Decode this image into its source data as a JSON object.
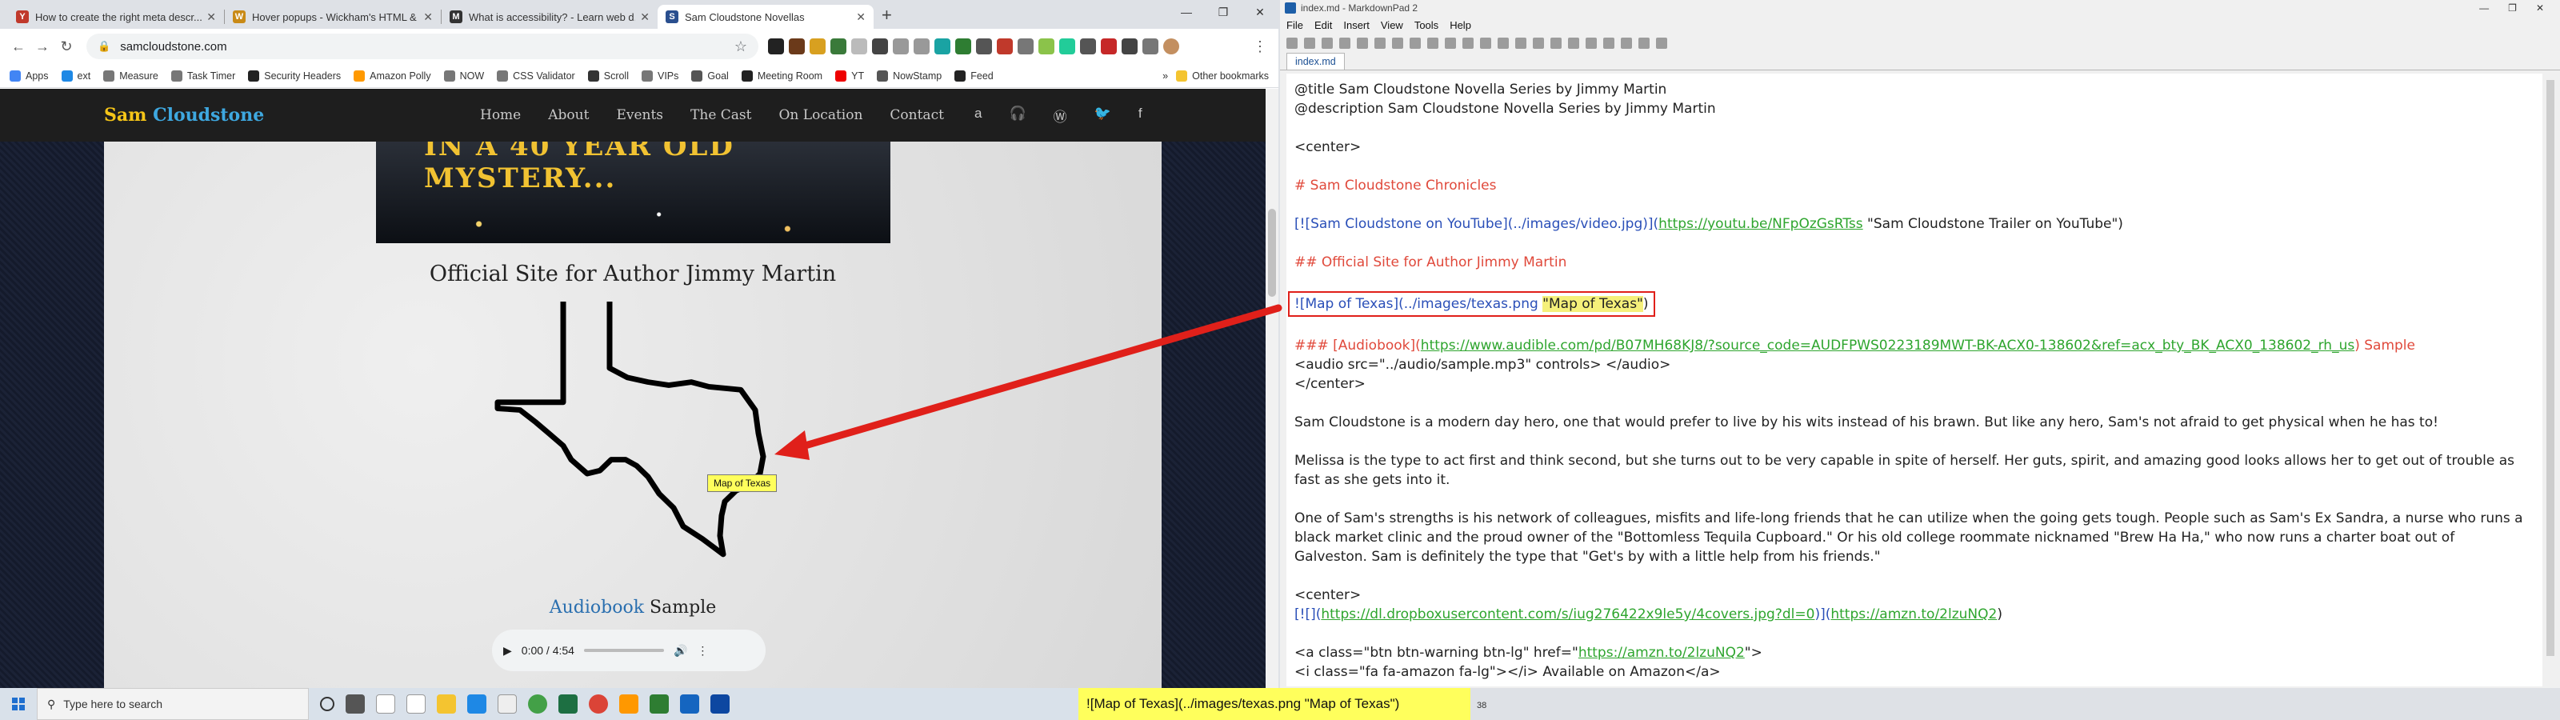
{
  "browser": {
    "tabs": [
      {
        "title": "How to create the right meta descr...",
        "fav_color": "#c0392b",
        "fav_letter": "Y"
      },
      {
        "title": "Hover popups - Wickham's HTML & ...",
        "fav_color": "#c98a16",
        "fav_letter": "W"
      },
      {
        "title": "What is accessibility? - Learn web d...",
        "fav_color": "#333",
        "fav_letter": "M"
      },
      {
        "title": "Sam Cloudstone Novellas",
        "fav_color": "#2a4f8f",
        "fav_letter": "S",
        "active": true
      }
    ],
    "new_tab_label": "+",
    "url": "samcloudstone.com",
    "bookmarks": [
      "Apps",
      "ext",
      "Measure",
      "Task Timer",
      "Security Headers",
      "Amazon Polly",
      "NOW",
      "CSS Validator",
      "Scroll",
      "VIPs",
      "Goal",
      "Meeting Room",
      "YT",
      "NowStamp",
      "Feed"
    ],
    "bookmarks_more": "»",
    "other_bookmarks": "Other bookmarks"
  },
  "site": {
    "brand_first": "Sam",
    "brand_second": "Cloudstone",
    "nav": [
      "Home",
      "About",
      "Events",
      "The Cast",
      "On Location",
      "Contact"
    ],
    "video_text": "IN A 40 YEAR OLD MYSTERY...",
    "heading": "Official Site for Author Jimmy Martin",
    "tooltip": "Map of Texas",
    "audiobook_link": "Audiobook",
    "audiobook_rest": " Sample",
    "audio_time": "0:00 / 4:54"
  },
  "editor": {
    "window_title": "index.md - MarkdownPad 2",
    "menu": [
      "File",
      "Edit",
      "Insert",
      "View",
      "Tools",
      "Help"
    ],
    "tab": "index.md",
    "lines": {
      "title": "@title Sam Cloudstone Novella Series by Jimmy Martin",
      "description": "@description Sam Cloudstone Novella Series by Jimmy Martin",
      "center_open": "<center>",
      "h1": "# Sam Cloudstone Chronicles",
      "video_a": "[![Sam Cloudstone on YouTube](../images/video.jpg)](",
      "video_url": "https://youtu.be/NFpOzGsRTss",
      "video_b": " \"Sam Cloudstone Trailer on YouTube\")",
      "h2": "## Official Site for Author Jimmy Martin",
      "img_a": "![Map of Texas](../images/texas.png ",
      "img_title": "\"Map of Texas\"",
      "img_b": ")",
      "h3_a": "### [Audiobook](",
      "h3_url": "https://www.audible.com/pd/B07MH68KJ8/?source_code=AUDFPWS0223189MWT-BK-ACX0-138602&ref=acx_bty_BK_ACX0_138602_rh_us",
      "h3_b": ") Sample",
      "audio_tag": "<audio src=\"../audio/sample.mp3\" controls> </audio>",
      "center_close": "</center>",
      "p1": "Sam Cloudstone is a modern day hero, one that would prefer to live by his wits instead of his brawn. But like any hero, Sam's not afraid to get physical when he has to!",
      "p2": "Melissa is the type to act first and think second, but she turns out to be very capable in spite of herself. Her guts, spirit, and amazing good looks allows her to get out of trouble as fast as she gets into it.",
      "p3": "One of Sam's strengths is his network of colleagues, misfits and life-long friends that he can utilize when the going gets tough. People such as Sam's Ex Sandra, a nurse who runs a black market clinic and the proud owner of the \"Bottomless Tequila Cupboard.\" Or his old college roommate nicknamed \"Brew Ha Ha,\" who now runs a charter boat out of Galveston. Sam is definitely the type that \"Get's by with a little help from his friends.\"",
      "center2": "<center>",
      "link2_a": "[![](",
      "link2_url": "https://dl.dropboxusercontent.com/s/iug276422x9le5y/4covers.jpg?dl=0",
      "link2_b": ")](",
      "link2_url2": "https://amzn.to/2lzuNQ2",
      "link2_c": ")",
      "a_open_a": "<a class=\"btn btn-warning btn-lg\" href=\"",
      "a_open_url": "https://amzn.to/2lzuNQ2",
      "a_open_b": "\">",
      "a_icon": "<i class=\"fa fa-amazon fa-lg\"></i> Available on Amazon</a>"
    },
    "status_tooltip": "![Map of Texas](../images/texas.png \"Map of Texas\")",
    "status_num": "38"
  },
  "taskbar": {
    "search_placeholder": "Type here to search"
  },
  "colors": {
    "arrow": "#e0201a",
    "brand_yellow": "#f5c518",
    "brand_blue": "#3ea8e0"
  }
}
